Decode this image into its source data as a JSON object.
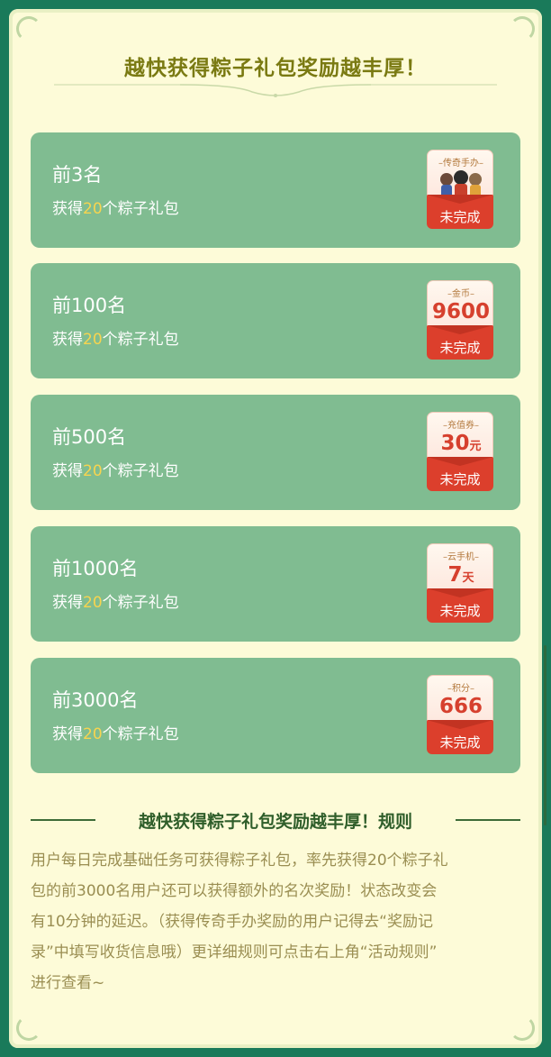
{
  "header": {
    "title": "越快获得粽子礼包奖励越丰厚！"
  },
  "cards": [
    {
      "rank": "前3名",
      "desc_prefix": "获得",
      "desc_num": "20",
      "desc_suffix": "个粽子礼包",
      "badge_tag": "–传奇手办–",
      "badge_value": "",
      "badge_unit": "",
      "badge_icon": "figurines-image",
      "status": "未完成"
    },
    {
      "rank": "前100名",
      "desc_prefix": "获得",
      "desc_num": "20",
      "desc_suffix": "个粽子礼包",
      "badge_tag": "–金币–",
      "badge_value": "9600",
      "badge_unit": "",
      "status": "未完成"
    },
    {
      "rank": "前500名",
      "desc_prefix": "获得",
      "desc_num": "20",
      "desc_suffix": "个粽子礼包",
      "badge_tag": "–充值券–",
      "badge_value": "30",
      "badge_unit": "元",
      "status": "未完成"
    },
    {
      "rank": "前1000名",
      "desc_prefix": "获得",
      "desc_num": "20",
      "desc_suffix": "个粽子礼包",
      "badge_tag": "–云手机–",
      "badge_value": "7",
      "badge_unit": "天",
      "status": "未完成"
    },
    {
      "rank": "前3000名",
      "desc_prefix": "获得",
      "desc_num": "20",
      "desc_suffix": "个粽子礼包",
      "badge_tag": "–积分–",
      "badge_value": "666",
      "badge_unit": "",
      "status": "未完成"
    }
  ],
  "rules": {
    "title": "越快获得粽子礼包奖励越丰厚！规则",
    "lines": [
      "用户每日完成基础任务可获得粽子礼包，率先获得20个粽子礼",
      "包的前3000名用户还可以获得额外的名次奖励！状态改变会",
      "有10分钟的延迟。（获得传奇手办奖励的用户记得去“奖励记",
      "录”中填写收货信息哦）更详细规则可点击右上角“活动规则”",
      "进行查看~"
    ]
  },
  "colors": {
    "card_bg": "#80bc91",
    "status_red": "#dc3f2c",
    "highlight": "#f7d44f",
    "page_bg": "#1a7a5a"
  }
}
